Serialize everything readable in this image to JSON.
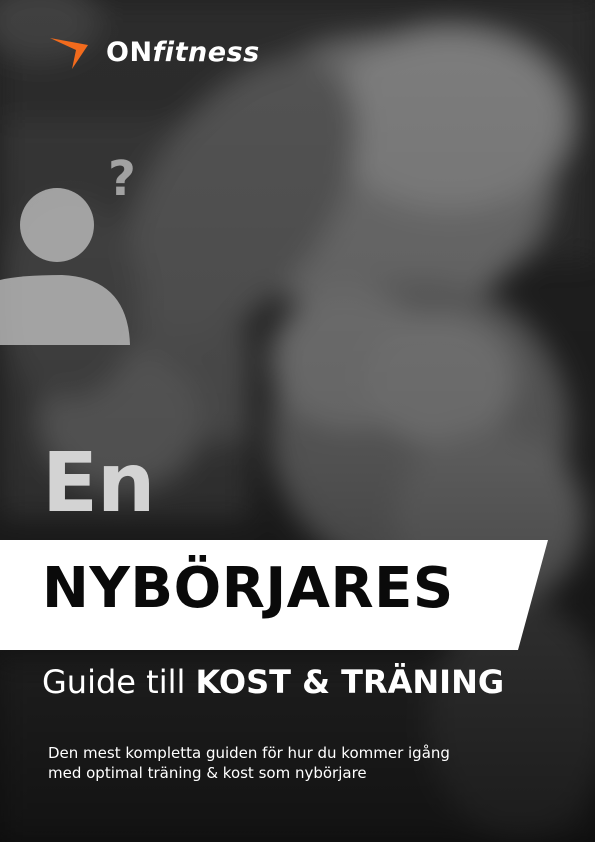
{
  "brand": {
    "name_prefix": "ON",
    "name_suffix": "fitness",
    "accent_color": "#f26b1d"
  },
  "icons": {
    "logo_mark": "orange-chevron-check-icon",
    "person_question": "person-question-icon"
  },
  "cover": {
    "title_small": "En",
    "title_main": "NYBÖRJARES",
    "subtitle_light": "Guide till ",
    "subtitle_bold": "KOST & TRÄNING",
    "description_line1": "Den mest kompletta guiden för hur du kommer igång",
    "description_line2": "med optimal träning & kost som nybörjare"
  }
}
